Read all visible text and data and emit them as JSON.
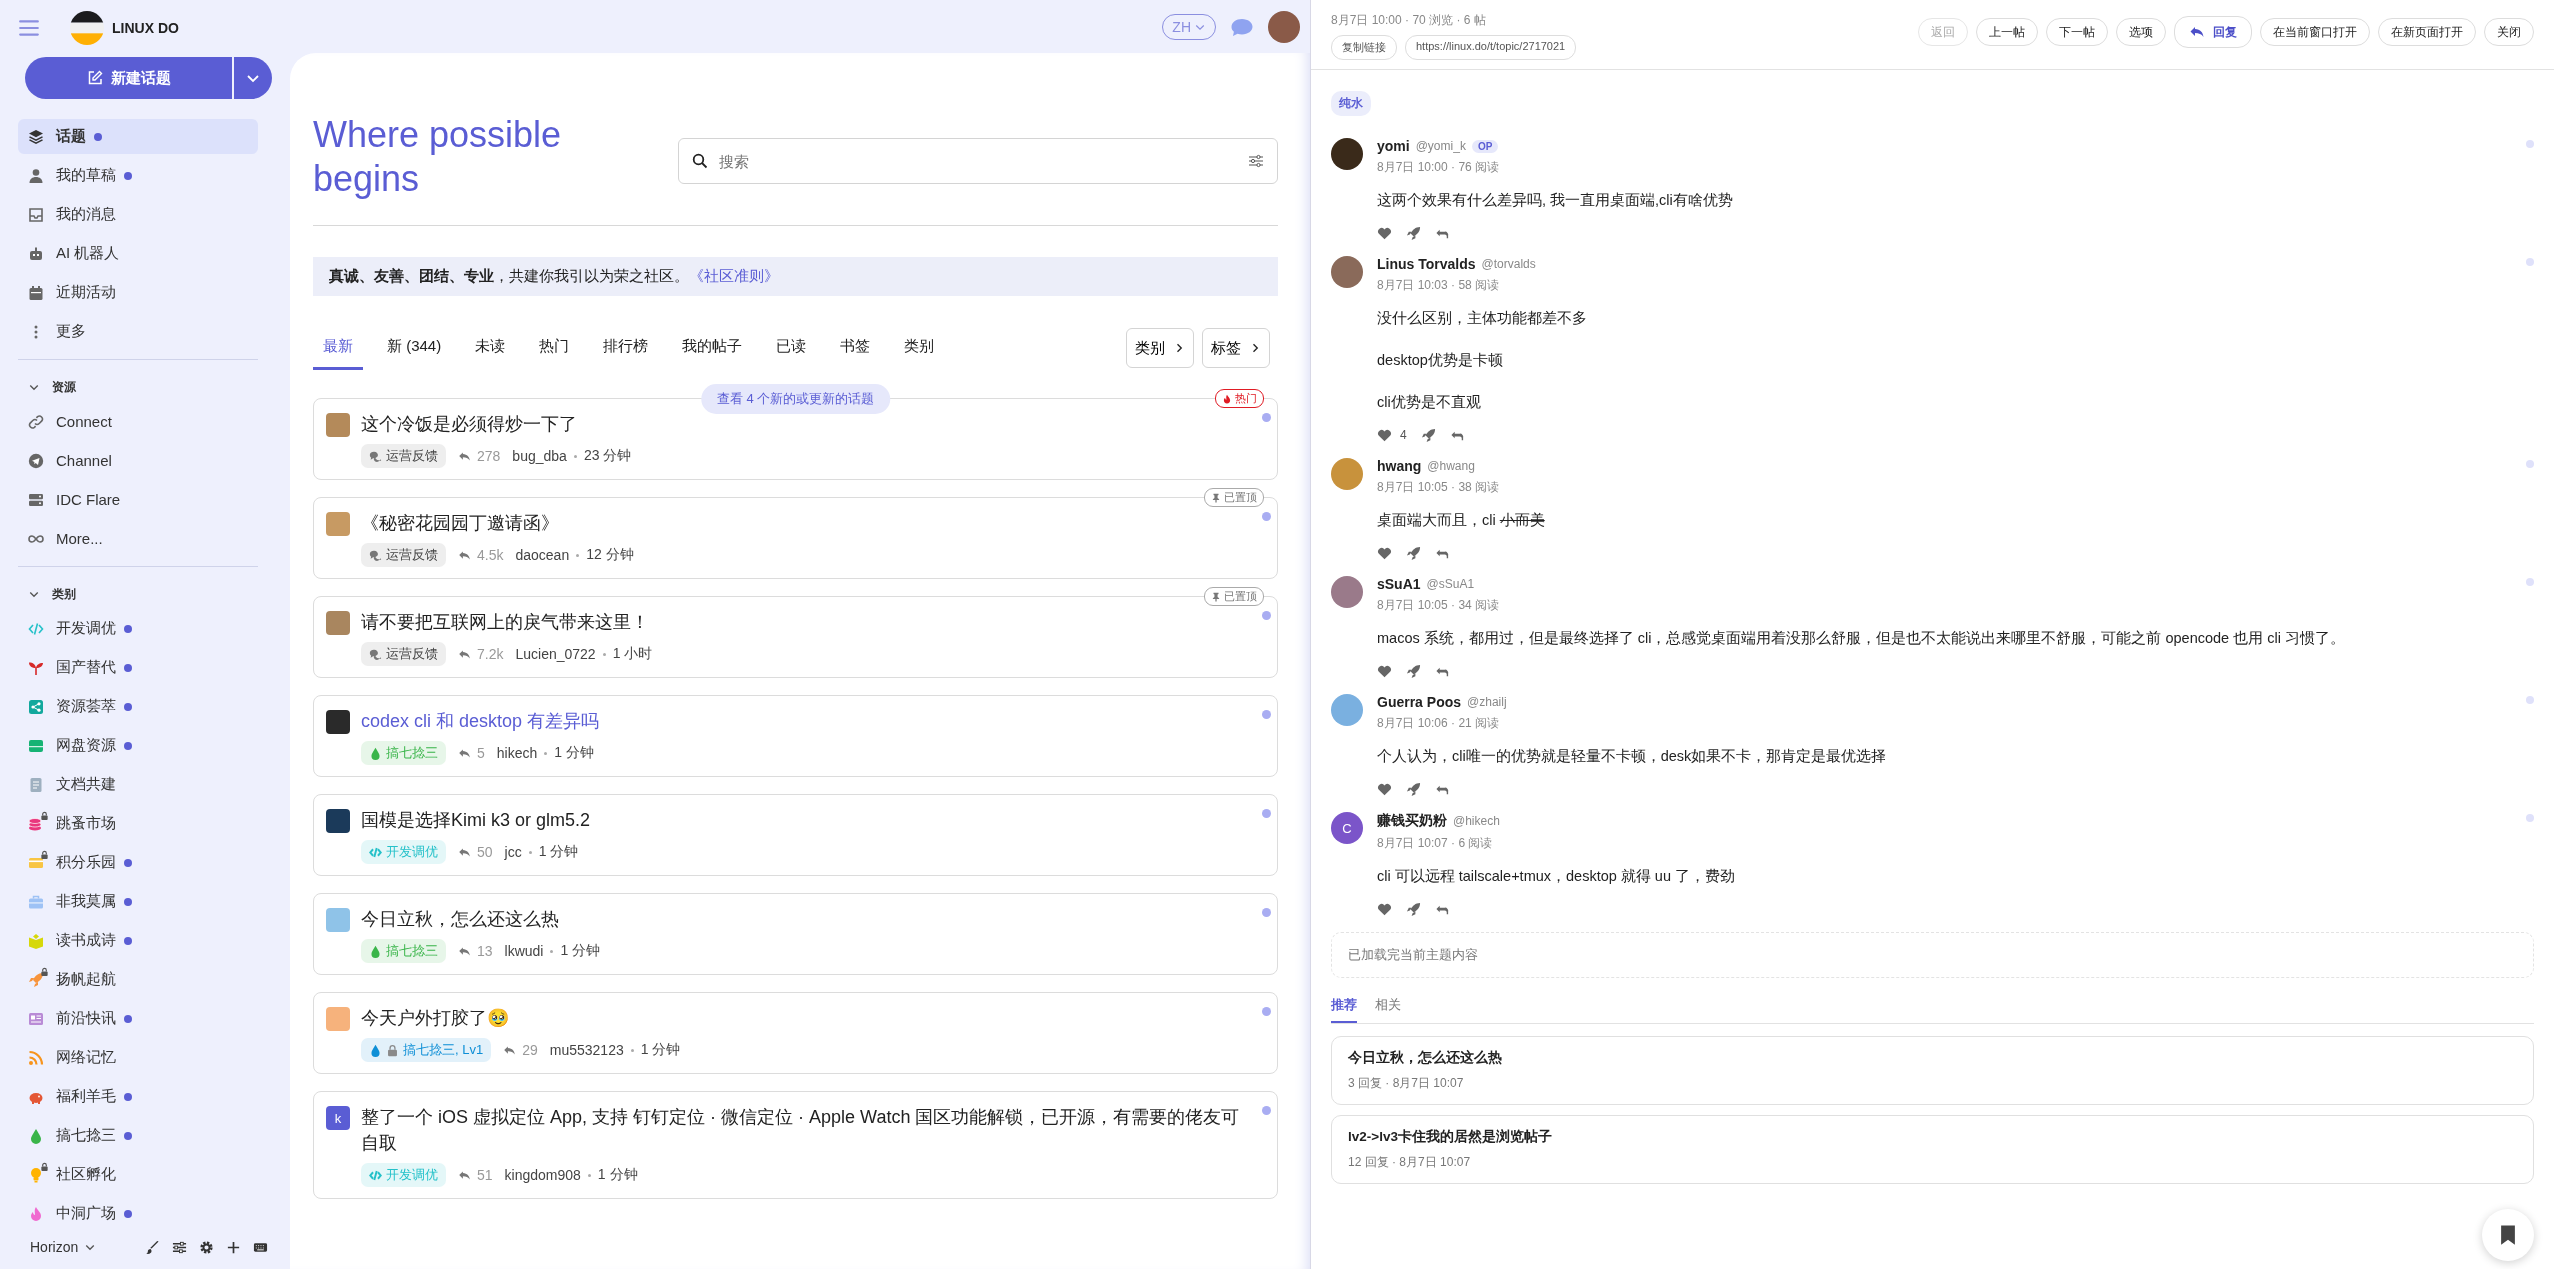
{
  "sidebar": {
    "logo_text": "LINUX DO",
    "new_topic_button": "新建话题",
    "nav": [
      {
        "label": "话题",
        "selected": true,
        "unread": true
      },
      {
        "label": "我的草稿",
        "selected": false,
        "unread": true
      },
      {
        "label": "我的消息",
        "selected": false,
        "unread": false
      },
      {
        "label": "AI 机器人",
        "selected": false,
        "unread": false
      },
      {
        "label": "近期活动",
        "selected": false,
        "unread": false
      },
      {
        "label": "更多",
        "selected": false,
        "unread": false
      }
    ],
    "resources": {
      "title": "资源",
      "expanded": true,
      "items": [
        {
          "label": "Connect"
        },
        {
          "label": "Channel"
        },
        {
          "label": "IDC Flare"
        },
        {
          "label": "More..."
        }
      ]
    },
    "categories": {
      "title": "类别",
      "expanded": true,
      "items": [
        {
          "label": "开发调优",
          "color": "#25c1c9",
          "locked": false,
          "unread": true
        },
        {
          "label": "国产替代",
          "color": "#d62828",
          "locked": false,
          "unread": true
        },
        {
          "label": "资源荟萃",
          "color": "#12a89d",
          "locked": false,
          "unread": true
        },
        {
          "label": "网盘资源",
          "color": "#16b374",
          "locked": false,
          "unread": true
        },
        {
          "label": "文档共建",
          "color": "#9eb0c0",
          "locked": false,
          "unread": false
        },
        {
          "label": "跳蚤市场",
          "color": "#e9367d",
          "locked": true,
          "unread": false
        },
        {
          "label": "积分乐园",
          "color": "#f8c543",
          "locked": true,
          "unread": true
        },
        {
          "label": "非我莫属",
          "color": "#9ec2f5",
          "locked": false,
          "unread": true
        },
        {
          "label": "读书成诗",
          "color": "#d6d80a",
          "locked": false,
          "unread": true
        },
        {
          "label": "扬帆起航",
          "color": "#f7943c",
          "locked": true,
          "unread": false
        },
        {
          "label": "前沿快讯",
          "color": "#b98bd6",
          "locked": false,
          "unread": true
        },
        {
          "label": "网络记忆",
          "color": "#f7941d",
          "locked": false,
          "unread": false
        },
        {
          "label": "福利羊毛",
          "color": "#e45735",
          "locked": false,
          "unread": true
        },
        {
          "label": "搞七捻三",
          "color": "#3ab54a",
          "locked": false,
          "unread": true
        },
        {
          "label": "社区孵化",
          "color": "#ffb300",
          "locked": true,
          "unread": false
        },
        {
          "label": "中洞广场",
          "color": "#f06ad0",
          "locked": false,
          "unread": true
        }
      ]
    },
    "footer": {
      "theme": "Horizon"
    }
  },
  "header": {
    "language": "ZH"
  },
  "hero": {
    "title": "Where possible begins"
  },
  "search": {
    "placeholder": "搜索"
  },
  "banner": {
    "text": "**真诚、友善、团结、专业**，共建你我引以为荣之社区。",
    "link": "《社区准则》"
  },
  "tabs": [
    {
      "label": "最新",
      "selected": true
    },
    {
      "label": "新 (344)",
      "selected": false
    },
    {
      "label": "未读",
      "selected": false
    },
    {
      "label": "热门",
      "selected": false
    },
    {
      "label": "排行榜",
      "selected": false
    },
    {
      "label": "我的帖子",
      "selected": false
    },
    {
      "label": "已读",
      "selected": false
    },
    {
      "label": "书签",
      "selected": false
    },
    {
      "label": "类别",
      "selected": false
    }
  ],
  "filters": [
    "类别",
    "标签"
  ],
  "new_topics_notice": "查看 4 个新的或更新的话题",
  "topics": [
    {
      "title": "这个冷饭是必须得炒一下了",
      "selected": false,
      "unread": true,
      "category": {
        "label": "运营反馈",
        "kind": "chat",
        "color": "#777777",
        "locked": false
      },
      "replies": "278",
      "author": "bug_dba",
      "time": "23 分钟",
      "badge": {
        "kind": "hot",
        "label": "热门"
      }
    },
    {
      "title": "《秘密花园园丁邀请函》",
      "selected": false,
      "unread": true,
      "category": {
        "label": "运营反馈",
        "kind": "chat",
        "color": "#777777",
        "locked": false
      },
      "replies": "4.5k",
      "author": "daocean",
      "time": "12 分钟",
      "badge": {
        "kind": "pinned",
        "label": "已置顶"
      }
    },
    {
      "title": "请不要把互联网上的戾气带来这里！",
      "selected": false,
      "unread": true,
      "category": {
        "label": "运营反馈",
        "kind": "chat",
        "color": "#777777",
        "locked": false
      },
      "replies": "7.2k",
      "author": "Lucien_0722",
      "time": "1 小时",
      "badge": {
        "kind": "pinned",
        "label": "已置顶"
      }
    },
    {
      "title": "codex cli 和 desktop 有差异吗",
      "selected": true,
      "unread": true,
      "category": {
        "label": "搞七捻三",
        "kind": "drop",
        "color": "#3ab54a",
        "locked": false
      },
      "replies": "5",
      "author": "hikech",
      "time": "1 分钟"
    },
    {
      "title": "国模是选择Kimi k3 or glm5.2",
      "selected": false,
      "unread": true,
      "category": {
        "label": "开发调优",
        "kind": "code",
        "color": "#25c1c9",
        "locked": false
      },
      "replies": "50",
      "author": "jcc",
      "time": "1 分钟"
    },
    {
      "title": "今日立秋，怎么还这么热",
      "selected": false,
      "unread": true,
      "category": {
        "label": "搞七捻三",
        "kind": "drop",
        "color": "#3ab54a",
        "locked": false
      },
      "replies": "13",
      "author": "lkwudi",
      "time": "1 分钟"
    },
    {
      "title": "今天户外打胶了🥹",
      "selected": false,
      "unread": true,
      "category": {
        "label": "搞七捻三, Lv1",
        "kind": "drop",
        "color": "#0e8fd6",
        "locked": true
      },
      "replies": "29",
      "author": "mu5532123",
      "time": "1 分钟"
    },
    {
      "title": "整了一个 iOS 虚拟定位 App, 支持 钉钉定位 · 微信定位 · Apple Watch 国区功能解锁，已开源，有需要的佬友可自取",
      "selected": false,
      "unread": true,
      "avatar_letter": "k",
      "category": {
        "label": "开发调优",
        "kind": "code",
        "color": "#25c1c9",
        "locked": false
      },
      "replies": "51",
      "author": "kingdom908",
      "time": "1 分钟"
    }
  ],
  "topic_panel": {
    "meta": "8月7日 10:00 · 70 浏览 · 6 帖",
    "copy_link": "复制链接",
    "url": "https://linux.do/t/topic/2717021",
    "actions": [
      {
        "label": "返回",
        "kind": "plain",
        "disabled": true
      },
      {
        "label": "上一帖",
        "kind": "plain",
        "disabled": false
      },
      {
        "label": "下一帖",
        "kind": "plain",
        "disabled": false
      },
      {
        "label": "选项",
        "kind": "plain",
        "disabled": false
      },
      {
        "label": "回复",
        "kind": "primary",
        "disabled": false
      },
      {
        "label": "在当前窗口打开",
        "kind": "plain",
        "disabled": false
      },
      {
        "label": "在新页面打开",
        "kind": "plain",
        "disabled": false
      },
      {
        "label": "关闭",
        "kind": "plain",
        "disabled": false
      }
    ],
    "tag": "纯水",
    "posts": [
      {
        "name": "yomi",
        "handle": "@yomi_k",
        "badge": "OP",
        "meta": "8月7日 10:00 · 76 阅读",
        "unread": true,
        "paragraphs": [
          {
            "text": "这两个效果有什么差异吗, 我一直用桌面端,cli有啥优势"
          }
        ]
      },
      {
        "name": "Linus Torvalds",
        "handle": "@torvalds",
        "meta": "8月7日 10:03 · 58 阅读",
        "unread": true,
        "likes": "4",
        "paragraphs": [
          {
            "text": "没什么区别，主体功能都差不多"
          },
          {
            "text": "desktop优势是卡顿"
          },
          {
            "text": "cli优势是不直观"
          }
        ]
      },
      {
        "name": "hwang",
        "handle": "@hwang",
        "meta": "8月7日 10:05 · 38 阅读",
        "unread": true,
        "paragraphs": [
          {
            "text": "桌面端大而且，cli ",
            "struck": "小而美"
          }
        ]
      },
      {
        "name": "sSuA1",
        "handle": "@sSuA1",
        "meta": "8月7日 10:05 · 34 阅读",
        "unread": true,
        "paragraphs": [
          {
            "text": "macos 系统，都用过，但是最终选择了 cli，总感觉桌面端用着没那么舒服，但是也不太能说出来哪里不舒服，可能之前 opencode 也用 cli 习惯了。"
          }
        ]
      },
      {
        "name": "Guerra Poos",
        "handle": "@zhailj",
        "meta": "8月7日 10:06 · 21 阅读",
        "unread": true,
        "paragraphs": [
          {
            "text": "个人认为，cli唯一的优势就是轻量不卡顿，desk如果不卡，那肯定是最优选择"
          }
        ]
      },
      {
        "name": "赚钱买奶粉",
        "handle": "@hikech",
        "meta": "8月7日 10:07 · 6 阅读",
        "unread": true,
        "avatar_letter": "C",
        "paragraphs": [
          {
            "text": "cli 可以远程 tailscale+tmux，desktop 就得 uu 了，费劲"
          }
        ]
      }
    ],
    "end_notice": "已加载完当前主题内容",
    "tabs": [
      {
        "label": "推荐",
        "selected": true
      },
      {
        "label": "相关",
        "selected": false
      }
    ],
    "suggested": [
      {
        "title": "今日立秋，怎么还这么热",
        "meta": "3 回复 · 8月7日 10:07"
      },
      {
        "title": "lv2->lv3卡住我的居然是浏览帖子",
        "meta": "12 回复 · 8月7日 10:07"
      }
    ]
  }
}
